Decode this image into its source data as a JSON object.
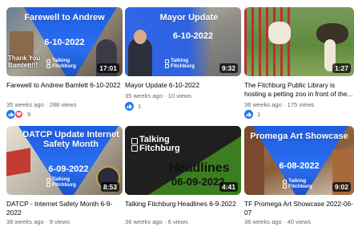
{
  "videos": [
    {
      "thumb_title": "Farewell to Andrew",
      "thumb_date": "6-10-2022",
      "thumb_caption": "Thank You Bamlett!!!",
      "logo_line1": "Talking",
      "logo_line2": "Fitchburg",
      "duration": "17:01",
      "title": "Farewell to Andrew Bamlett 6-10-2022",
      "meta": "35 weeks ago · 288 views",
      "reactions": [
        "like-icon",
        "love-icon"
      ],
      "reaction_count": "9"
    },
    {
      "thumb_title": "Mayor Update",
      "thumb_date": "6-10-2022",
      "logo_line1": "Talking",
      "logo_line2": "Fitchburg",
      "duration": "9:32",
      "title": "Mayor Update 6-10-2022",
      "meta": "35 weeks ago · 10 views",
      "reactions": [
        "like-icon"
      ],
      "reaction_count": "1"
    },
    {
      "duration": "1:27",
      "title": "The Fitchburg Public Library is hosting a petting zoo in front of the...",
      "meta": "36 weeks ago · 175 views",
      "reactions": [
        "like-icon"
      ],
      "reaction_count": "1"
    },
    {
      "thumb_title": "DATCP Update Internet Safety Month",
      "thumb_date": "6-09-2022",
      "logo_line1": "Talking",
      "logo_line2": "Fitchburg",
      "duration": "8:53",
      "title": "DATCP - Internet Safety Month 6-9-2022",
      "meta": "36 weeks ago · 9 views"
    },
    {
      "logo_line1": "Talking",
      "logo_line2": "Fitchburg",
      "thumb_title": "Headlines",
      "thumb_date": "06-09-2022",
      "duration": "4:41",
      "title": "Talking Fitchburg Headlines 6-9-2022",
      "meta": "36 weeks ago · 6 views"
    },
    {
      "thumb_title": "Promega Art Showcase",
      "thumb_date": "6-08-2022",
      "logo_line1": "Talking",
      "logo_line2": "Fitchburg",
      "duration": "9:02",
      "title": "TF Promega Art Showcase 2022-06-07",
      "meta": "36 weeks ago · 40 views"
    }
  ],
  "colors": {
    "banner_blue": "#1f5fe6",
    "like": "#1877f2",
    "love": "#f33e58",
    "meta_text": "#65676b"
  }
}
